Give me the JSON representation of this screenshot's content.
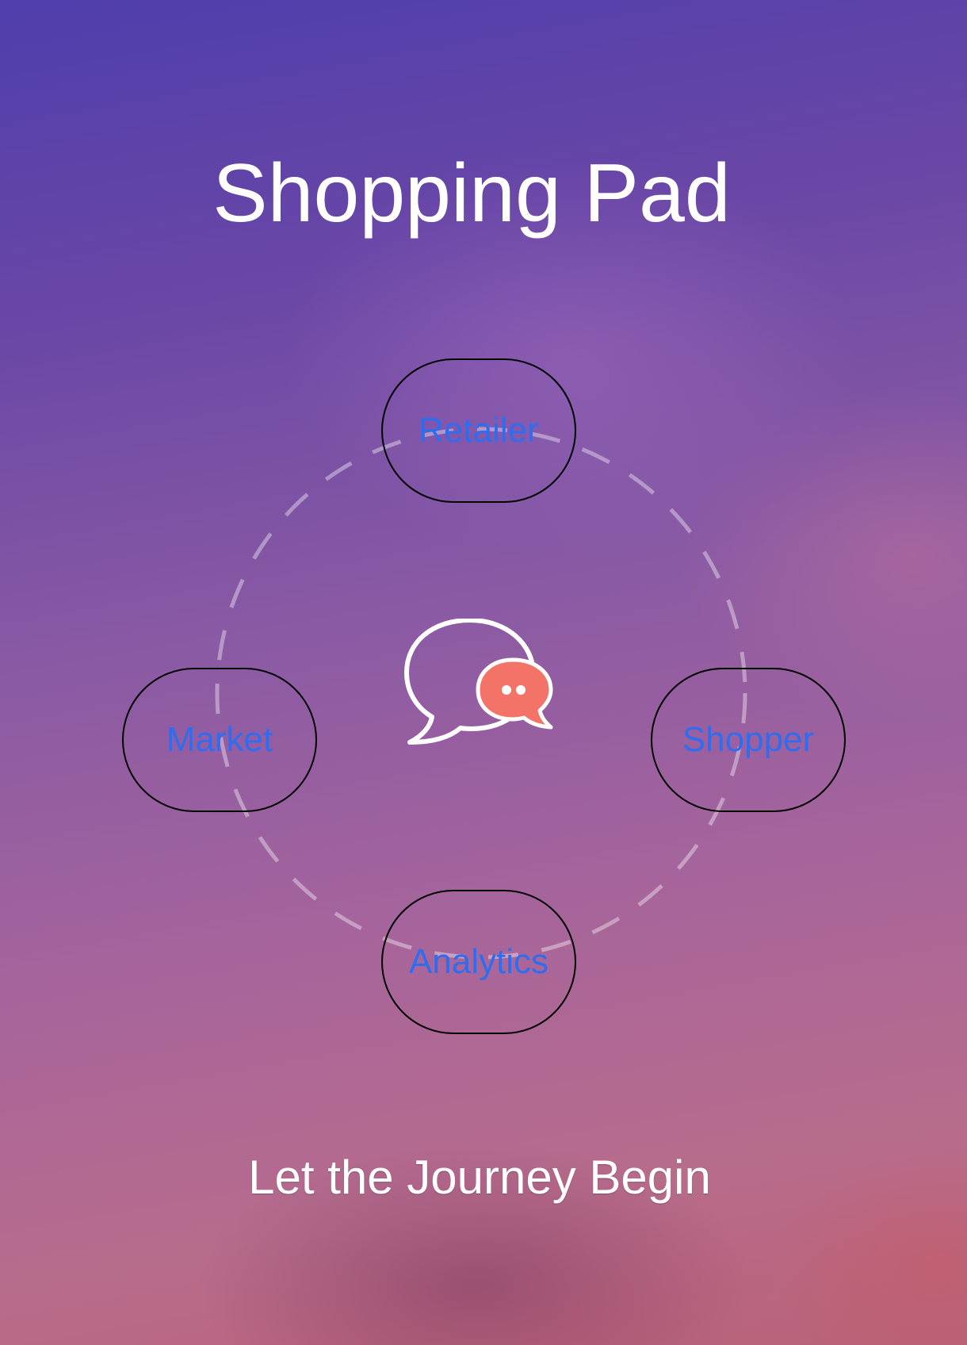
{
  "header": {
    "title": "Shopping Pad"
  },
  "menu": {
    "retailer_label": "Retailer",
    "market_label": "Market",
    "shopper_label": "Shopper",
    "analytics_label": "Analytics"
  },
  "center": {
    "icon": "chat-bubbles-icon",
    "accent_color": "#f47368"
  },
  "footer": {
    "tagline": "Let the Journey Begin"
  },
  "colors": {
    "button_text": "#2f6df0",
    "button_border": "#000000",
    "title_text": "#ffffff"
  }
}
